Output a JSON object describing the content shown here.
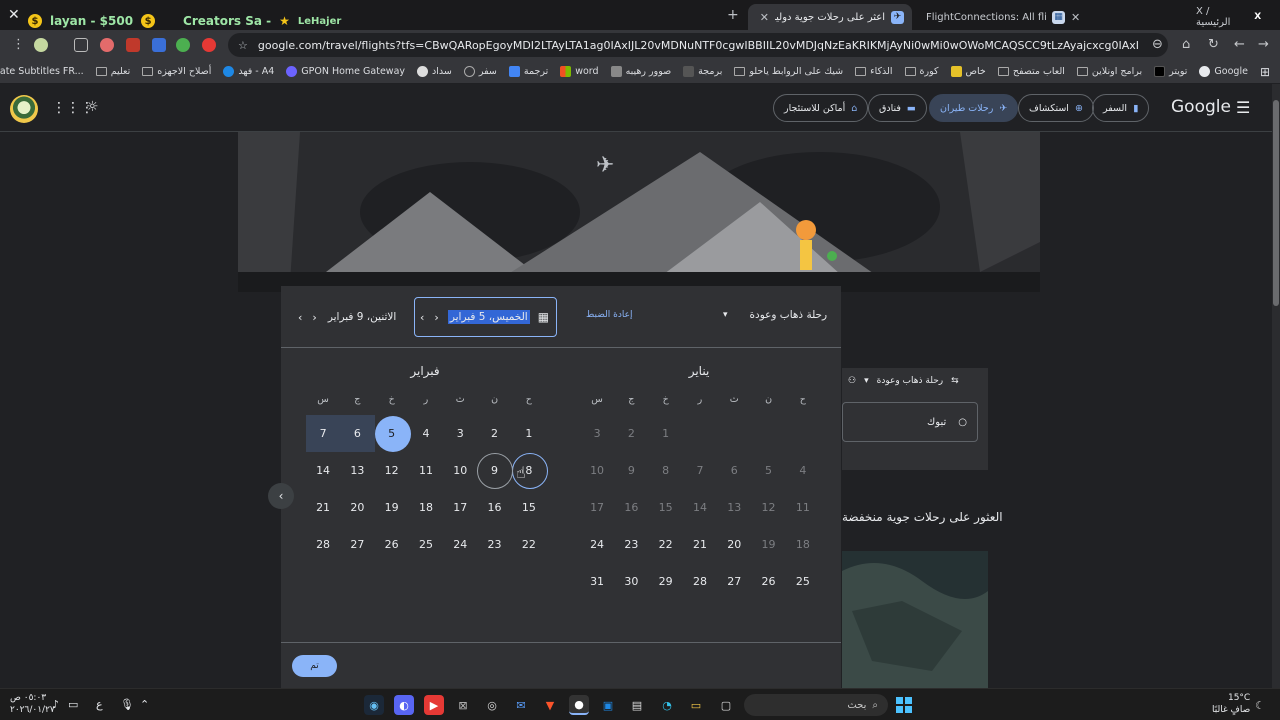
{
  "tabs": [
    {
      "title": "Twitter / X",
      "label": "X / الرئيسية",
      "icon": "x-icon"
    },
    {
      "title": "FlightConnections: All flights world...",
      "label": "FlightConnections: All flights world",
      "icon": "flight-icon"
    },
    {
      "title": "اعثر على رحلات جوية دولية رخيصة و",
      "label": "اعثر على رحلات جوية دولية رخيصة و",
      "icon": "google-flights-icon"
    }
  ],
  "extension_strip": {
    "name_1": "layan - $500",
    "name_2": "Creators Sa -",
    "name_3": "LeHajer"
  },
  "address": {
    "url": "google.com/travel/flights?tfs=CBwQARopEgoyMDI2LTAyLTA1ag0IAxIJL20vMDNuNTF0cgwIBBIIL20vMDJqNzEaKRIKMjAyNi0wMi0wOWoMCAQSCC9tLzAyajcxcg0IAxIJL20vMDNuNTF0QAFIAXABggELCP..."
  },
  "bookmarks": [
    "Google",
    "تويتر",
    "برامج اونلاين",
    "العاب متصفح",
    "خاص",
    "كورة",
    "الذكاء",
    "شيك على الروابط ياحلو",
    "برمجة",
    "صوور رهيبه",
    "word",
    "ترجمة",
    "سفر",
    "سداد",
    "GPON Home Gateway",
    "فهد - A4",
    "أصلاح الاجهزه",
    "تعليم",
    "Translate Subtitles FR..."
  ],
  "header": {
    "logo": "Google",
    "nav": [
      {
        "label": "السفر",
        "icon": "suitcase-icon",
        "active": false
      },
      {
        "label": "استكشاف",
        "icon": "explore-icon",
        "active": false
      },
      {
        "label": "رحلات طيران",
        "icon": "plane-icon",
        "active": true
      },
      {
        "label": "فنادق",
        "icon": "bed-icon",
        "active": false
      },
      {
        "label": "أماكن للاستئجار",
        "icon": "home-icon",
        "active": false
      }
    ]
  },
  "background": {
    "trip_type": "رحلة ذهاب وعودة",
    "origin": "تبوك",
    "section_title": "العثور على رحلات جوية منخفضة"
  },
  "dialog": {
    "trip_type": "رحلة ذهاب وعودة",
    "reset_label": "إعادة الضبط",
    "depart_date": "الخميس، 5 فبراير",
    "return_date": "الاثنين، 9 فبراير",
    "done_label": "تم",
    "months": [
      {
        "title": "يناير",
        "dow": [
          "ح",
          "ن",
          "ث",
          "ر",
          "خ",
          "ج",
          "س"
        ],
        "weeks": [
          [
            null,
            null,
            null,
            null,
            1,
            2,
            3
          ],
          [
            4,
            5,
            6,
            7,
            8,
            9,
            10
          ],
          [
            11,
            12,
            13,
            14,
            15,
            16,
            17
          ],
          [
            18,
            19,
            20,
            21,
            22,
            23,
            24
          ],
          [
            25,
            26,
            27,
            28,
            29,
            30,
            31
          ]
        ]
      },
      {
        "title": "فبراير",
        "dow": [
          "ح",
          "ن",
          "ث",
          "ر",
          "خ",
          "ج",
          "س"
        ],
        "weeks": [
          [
            1,
            2,
            3,
            4,
            5,
            6,
            7
          ],
          [
            8,
            9,
            10,
            11,
            12,
            13,
            14
          ],
          [
            15,
            16,
            17,
            18,
            19,
            20,
            21
          ],
          [
            22,
            23,
            24,
            25,
            26,
            27,
            28
          ]
        ]
      }
    ]
  },
  "taskbar": {
    "search_placeholder": "بحث",
    "time": "٠٥:٠٣ ص",
    "date": "٢٠٢٦/٠١/٢٧",
    "weather_temp": "15°C",
    "weather_desc": "صافٍ غالبًا",
    "lang": "ع"
  },
  "colors": {
    "accent": "#8ab4f8",
    "range": "#394457",
    "surface": "#303134",
    "background": "#202124"
  }
}
